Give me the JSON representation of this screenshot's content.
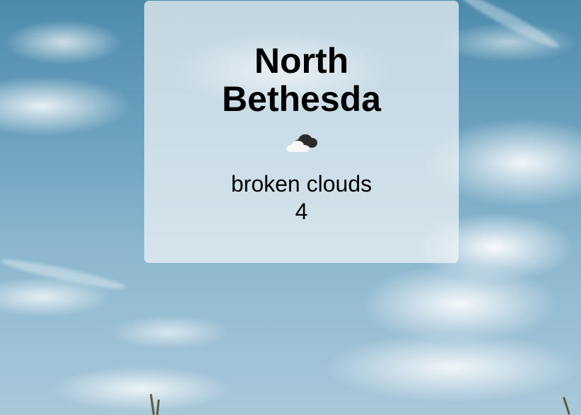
{
  "location": {
    "city": "North Bethesda"
  },
  "weather": {
    "description": "broken clouds",
    "temperature": "4",
    "icon": "cloud-icon"
  }
}
